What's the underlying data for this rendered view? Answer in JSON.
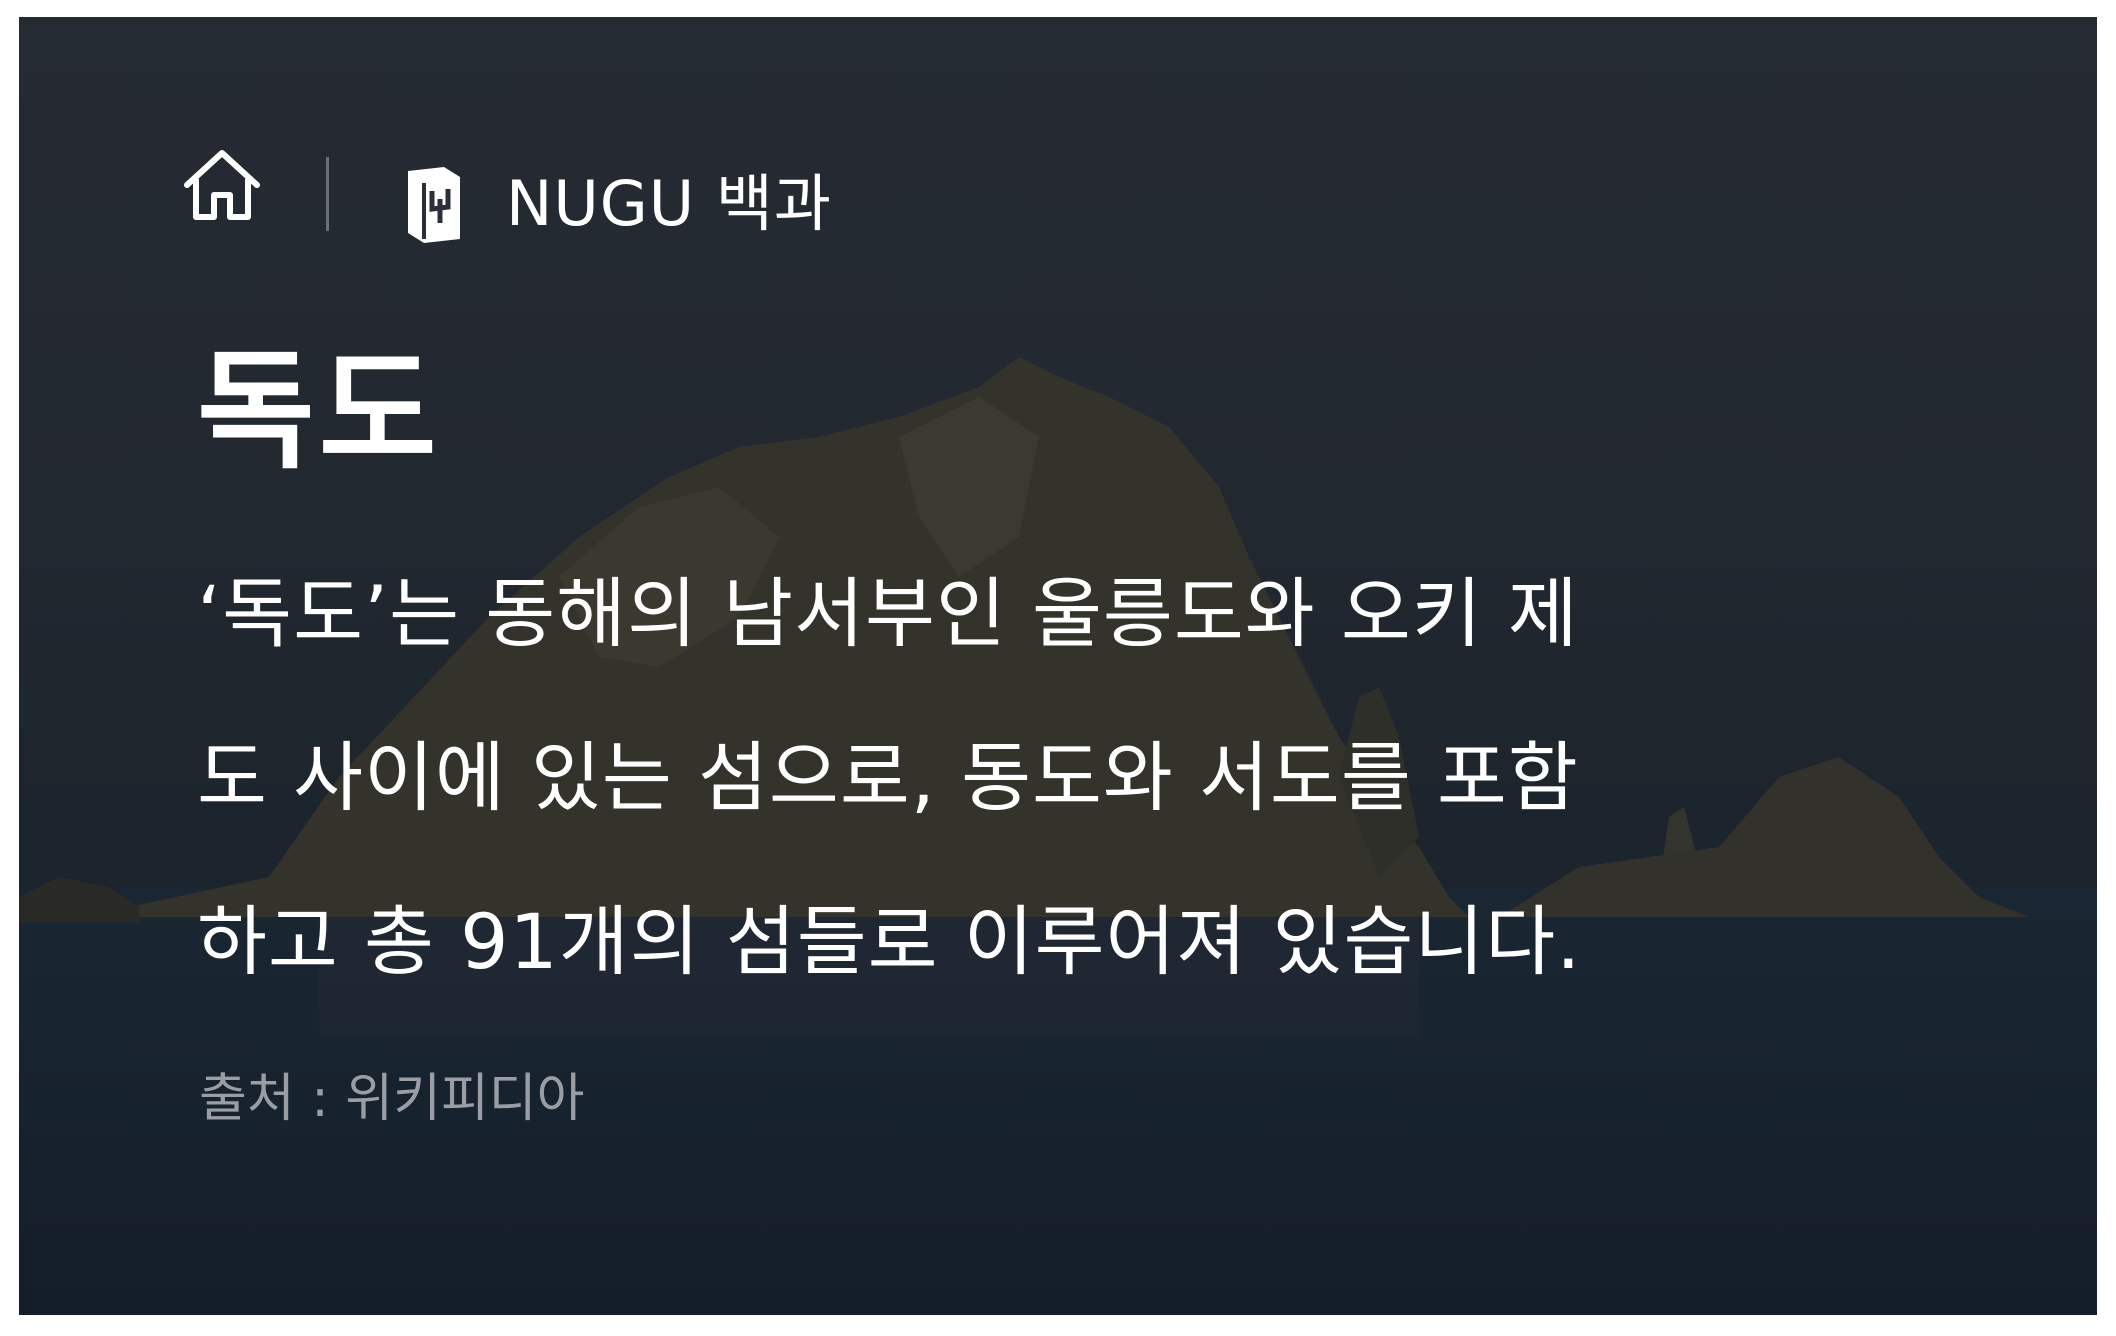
{
  "header": {
    "home_icon": "home-icon",
    "service_icon": "book-icon",
    "service_name": "NUGU 백과"
  },
  "article": {
    "title": "독도",
    "body_lines": [
      "‘독도’는 동해의 남서부인 울릉도와 오키 제",
      "도 사이에 있는 섬으로, 동도와 서도를 포함",
      "하고 총 91개의 섬들로 이루어져 있습니다."
    ],
    "source": "출처 : 위키피디아"
  },
  "colors": {
    "text_primary": "#ffffff",
    "text_secondary": "#9a9da3",
    "background_overlay": "#262c35"
  }
}
